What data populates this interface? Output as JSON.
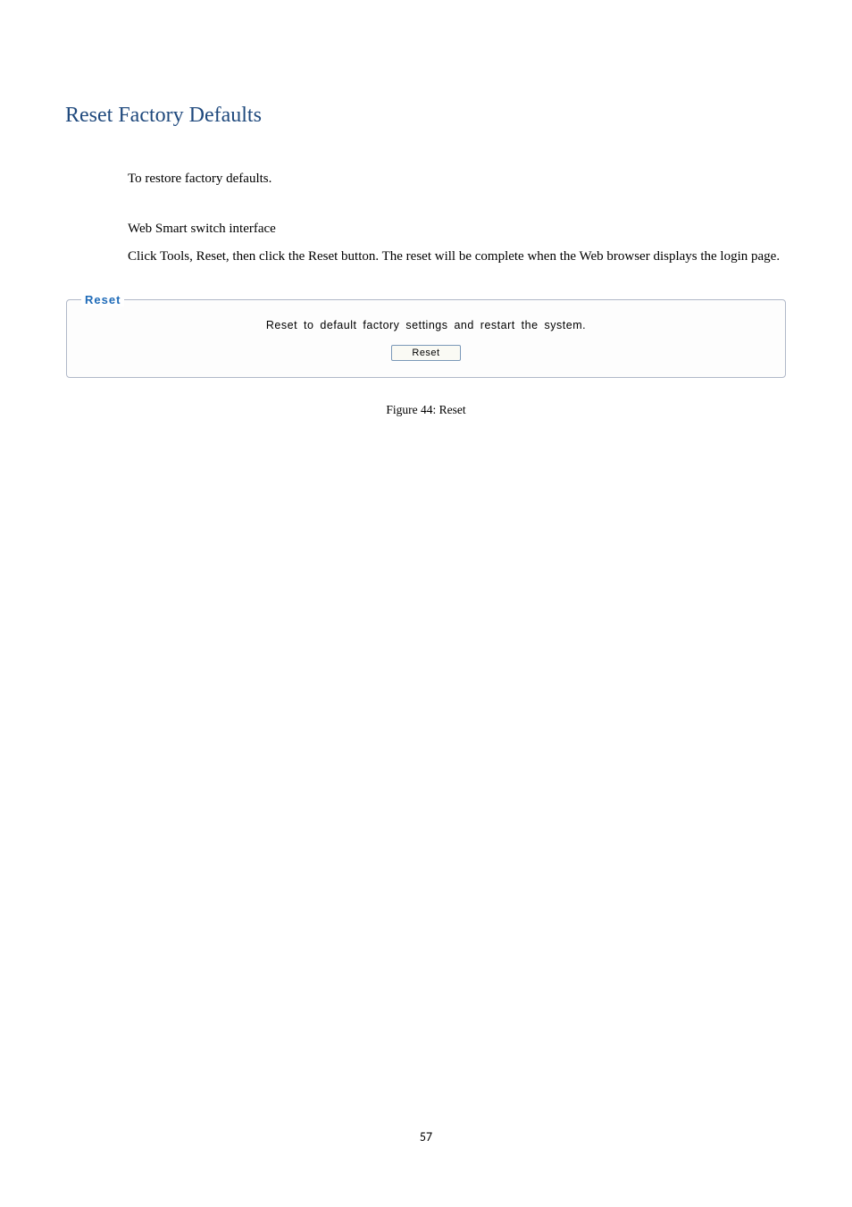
{
  "heading": "Reset Factory Defaults",
  "intro": "To restore factory defaults.",
  "subheading": "Web Smart switch interface",
  "instructions": "Click Tools, Reset, then click the Reset button. The reset will be complete when the Web browser displays the login page.",
  "fieldset": {
    "legend": "Reset",
    "description": "Reset to default factory settings and restart the system.",
    "button_label": "Reset"
  },
  "figure_caption": "Figure 44: Reset",
  "page_number": "57"
}
